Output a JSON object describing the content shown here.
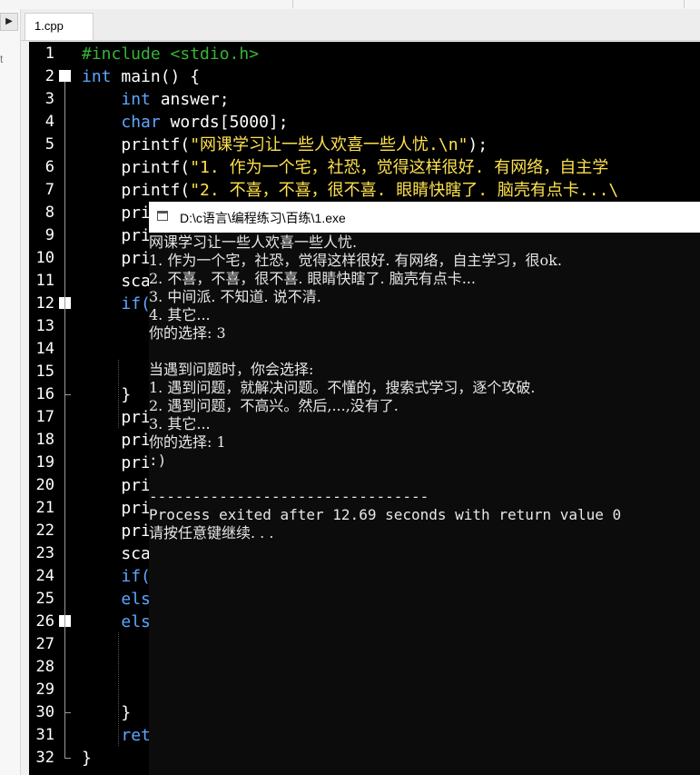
{
  "tab": {
    "label": "1.cpp"
  },
  "left_panel": {
    "arrow": "▶",
    "char": "t"
  },
  "editor": {
    "lines": [
      {
        "n": "1",
        "parts": [
          {
            "t": "#include <stdio.h>",
            "c": "pp"
          }
        ]
      },
      {
        "n": "2",
        "fold": "start",
        "parts": [
          {
            "t": "int",
            "c": "kw"
          },
          {
            "t": " main() {",
            "c": ""
          }
        ]
      },
      {
        "n": "3",
        "parts": [
          {
            "t": "    ",
            "c": ""
          },
          {
            "t": "int",
            "c": "kw"
          },
          {
            "t": " answer;",
            "c": ""
          }
        ]
      },
      {
        "n": "4",
        "parts": [
          {
            "t": "    ",
            "c": ""
          },
          {
            "t": "char",
            "c": "kw"
          },
          {
            "t": " words[5000];",
            "c": ""
          }
        ]
      },
      {
        "n": "5",
        "parts": [
          {
            "t": "    printf(",
            "c": ""
          },
          {
            "t": "\"网课学习让一些人欢喜一些人忧.\\n\"",
            "c": "str"
          },
          {
            "t": ");",
            "c": ""
          }
        ]
      },
      {
        "n": "6",
        "parts": [
          {
            "t": "    printf(",
            "c": ""
          },
          {
            "t": "\"1. 作为一个宅，社恐，觉得这样很好. 有网络，自主学",
            "c": "str"
          }
        ]
      },
      {
        "n": "7",
        "parts": [
          {
            "t": "    printf(",
            "c": ""
          },
          {
            "t": "\"2. 不喜，不喜，很不喜. 眼睛快瞎了. 脑壳有点卡...\\",
            "c": "str"
          }
        ]
      },
      {
        "n": "8",
        "parts": [
          {
            "t": "    pri",
            "c": ""
          }
        ]
      },
      {
        "n": "9",
        "parts": [
          {
            "t": "    pri",
            "c": ""
          }
        ]
      },
      {
        "n": "10",
        "parts": [
          {
            "t": "    pri",
            "c": ""
          }
        ]
      },
      {
        "n": "11",
        "parts": [
          {
            "t": "    sca",
            "c": ""
          }
        ]
      },
      {
        "n": "12",
        "fold": "start",
        "parts": [
          {
            "t": "    ",
            "c": ""
          },
          {
            "t": "if(",
            "c": "kw"
          }
        ]
      },
      {
        "n": "13",
        "parts": []
      },
      {
        "n": "14",
        "parts": []
      },
      {
        "n": "15",
        "parts": []
      },
      {
        "n": "16",
        "fold": "end",
        "parts": [
          {
            "t": "    }",
            "c": ""
          }
        ]
      },
      {
        "n": "17",
        "parts": [
          {
            "t": "    pri",
            "c": ""
          }
        ]
      },
      {
        "n": "18",
        "parts": [
          {
            "t": "    pri",
            "c": ""
          }
        ]
      },
      {
        "n": "19",
        "parts": [
          {
            "t": "    pri",
            "c": ""
          }
        ]
      },
      {
        "n": "20",
        "parts": [
          {
            "t": "    pri",
            "c": ""
          }
        ]
      },
      {
        "n": "21",
        "parts": [
          {
            "t": "    pri",
            "c": ""
          }
        ]
      },
      {
        "n": "22",
        "parts": [
          {
            "t": "    pri",
            "c": ""
          }
        ]
      },
      {
        "n": "23",
        "parts": [
          {
            "t": "    sca",
            "c": ""
          }
        ]
      },
      {
        "n": "24",
        "parts": [
          {
            "t": "    ",
            "c": ""
          },
          {
            "t": "if(",
            "c": "kw"
          }
        ]
      },
      {
        "n": "25",
        "parts": [
          {
            "t": "    ",
            "c": ""
          },
          {
            "t": "els",
            "c": "kw"
          }
        ]
      },
      {
        "n": "26",
        "fold": "start",
        "parts": [
          {
            "t": "    ",
            "c": ""
          },
          {
            "t": "els",
            "c": "kw"
          }
        ]
      },
      {
        "n": "27",
        "parts": []
      },
      {
        "n": "28",
        "parts": []
      },
      {
        "n": "29",
        "parts": []
      },
      {
        "n": "30",
        "fold": "end",
        "parts": [
          {
            "t": "    }",
            "c": ""
          }
        ]
      },
      {
        "n": "31",
        "parts": [
          {
            "t": "    ",
            "c": ""
          },
          {
            "t": "ret",
            "c": "kw"
          }
        ]
      },
      {
        "n": "32",
        "fold": "end",
        "parts": [
          {
            "t": "}",
            "c": ""
          }
        ]
      }
    ]
  },
  "console": {
    "title": "D:\\c语言\\编程练习\\百练\\1.exe",
    "lines": [
      "网课学习让一些人欢喜一些人忧.",
      "1. 作为一个宅，社恐，觉得这样很好. 有网络，自主学习，很ok.",
      "2. 不喜，不喜，很不喜. 眼睛快瞎了. 脑壳有点卡...",
      "3. 中间派. 不知道. 说不清.",
      "4. 其它...",
      "你的选择: 3",
      "",
      "当遇到问题时，你会选择:",
      "1. 遇到问题，就解决问题。不懂的，搜索式学习，逐个攻破.",
      "2. 遇到问题，不高兴。然后,...,没有了.",
      "3. 其它...",
      "你的选择: 1",
      ":)",
      "",
      "--------------------------------",
      "Process exited after 12.69 seconds with return value 0",
      "请按任意键继续. . ."
    ]
  }
}
